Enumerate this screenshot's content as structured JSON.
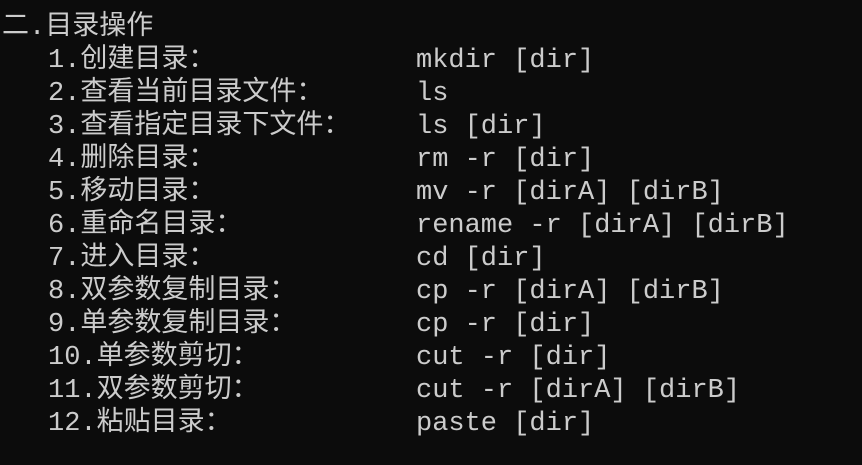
{
  "terminal": {
    "background": "#0c0c0c",
    "foreground": "#cccccc",
    "title": "二.目录操作",
    "items": [
      {
        "label": "1.创建目录：",
        "command": "mkdir [dir]"
      },
      {
        "label": "2.查看当前目录文件：",
        "command": "ls"
      },
      {
        "label": "3.查看指定目录下文件：",
        "command": "ls [dir]"
      },
      {
        "label": "4.删除目录：",
        "command": "rm -r [dir]"
      },
      {
        "label": "5.移动目录：",
        "command": "mv -r [dirA] [dirB]"
      },
      {
        "label": "6.重命名目录：",
        "command": "rename -r [dirA] [dirB]"
      },
      {
        "label": "7.进入目录：",
        "command": "cd [dir]"
      },
      {
        "label": "8.双参数复制目录：",
        "command": "cp -r [dirA] [dirB]"
      },
      {
        "label": "9.单参数复制目录：",
        "command": "cp -r [dir]"
      },
      {
        "label": "10.单参数剪切：",
        "command": "cut -r [dir]"
      },
      {
        "label": "11.双参数剪切：",
        "command": "cut -r [dirA] [dirB]"
      },
      {
        "label": "12.粘贴目录：",
        "command": "paste [dir]"
      }
    ]
  }
}
